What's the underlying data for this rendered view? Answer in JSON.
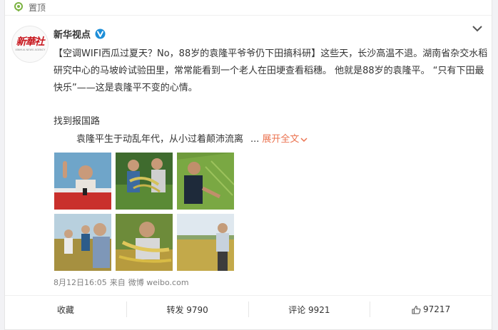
{
  "pin": {
    "label": "置顶",
    "icon": "pin-location-icon"
  },
  "author": {
    "name": "新华视点",
    "avatar_logo": "新華社",
    "avatar_sub": "XINHUA NEWS AGENCY",
    "verified_icon": "verified-v-icon"
  },
  "post": {
    "text": "【空调WIFI西瓜过夏天？No，88岁的袁隆平爷爷仍下田搞科研】这些天，长沙高温不退。湖南省杂交水稻研究中心的马坡岭试验田里，常常能看到一个老人在田埂查看稻穗。 他就是88岁的袁隆平。 “只有下田最快乐”——这是袁隆平不变的心情。",
    "section_title": "找到报国路",
    "excerpt": "袁隆平生于动乱年代，从小过着颠沛流离",
    "ellipsis": "...",
    "expand_label": "展开全文"
  },
  "meta": {
    "time": "8月12日16:05",
    "from_label": "来自",
    "source": "微博 weibo.com"
  },
  "actions": {
    "favorite": "收藏",
    "repost": "转发 9790",
    "comment": "评论 9921",
    "like": "97217"
  },
  "colors": {
    "link": "#eb7350",
    "verified": "#1d8ed8",
    "pin": "#7cb342"
  }
}
